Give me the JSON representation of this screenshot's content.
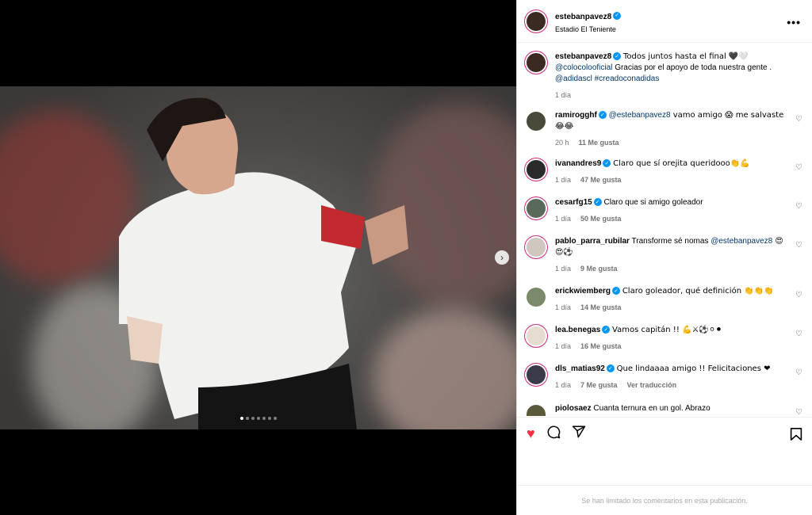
{
  "header": {
    "username": "estebanpavez8",
    "location": "Estadio El Teniente",
    "more_label": "•••"
  },
  "caption": {
    "username": "estebanpavez8",
    "text1": "Todos juntos hasta el final 🖤🤍",
    "mention": "@colocolooficial",
    "text2": " Gracias por el apoyo de toda nuestra gente .",
    "mention2": "@adidascl",
    "hashtag": "#creadoconadidas",
    "time": "1 día"
  },
  "comments": [
    {
      "user": "ramirogghf",
      "verified": true,
      "mention": "@estebanpavez8",
      "text": " vamo amigo 😱 me salvaste",
      "line2": "😂😂",
      "time": "20 h",
      "likes": "11 Me gusta"
    },
    {
      "user": "ivanandres9",
      "verified": true,
      "text": "Claro que sí orejita queridooo👏💪",
      "time": "1 día",
      "likes": "47 Me gusta"
    },
    {
      "user": "cesarfg15",
      "verified": true,
      "text": "Claro que si amigo goleador",
      "time": "1 día",
      "likes": "50 Me gusta"
    },
    {
      "user": "pablo_parra_rubilar",
      "verified": false,
      "text": "Transforme sé nomas ",
      "mention": "@estebanpavez8",
      "text_after": " 😍",
      "line2": "😍⚽",
      "time": "1 día",
      "likes": "9 Me gusta"
    },
    {
      "user": "erickwiemberg",
      "verified": true,
      "text": "Claro goleador, qué definición 👏👏👏",
      "time": "1 día",
      "likes": "14 Me gusta"
    },
    {
      "user": "lea.benegas",
      "verified": true,
      "text": "Vamos capitán !! 💪⚔⚽⚪⚫",
      "time": "1 día",
      "likes": "16 Me gusta"
    },
    {
      "user": "dls_matias92",
      "verified": true,
      "text": "Que lindaaaa amigo !! Felicitaciones ❤",
      "time": "1 día",
      "likes": "7 Me gusta",
      "translate": "Ver traducción"
    },
    {
      "user": "piolosaez",
      "verified": false,
      "text": "Cuanta ternura en un gol. Abrazo"
    }
  ],
  "footer": {
    "limited": "Se han limitado los comentarios en esta publicación."
  },
  "colors": {
    "accent": "#0095f6",
    "like": "#ff3040",
    "link": "#00376b"
  }
}
